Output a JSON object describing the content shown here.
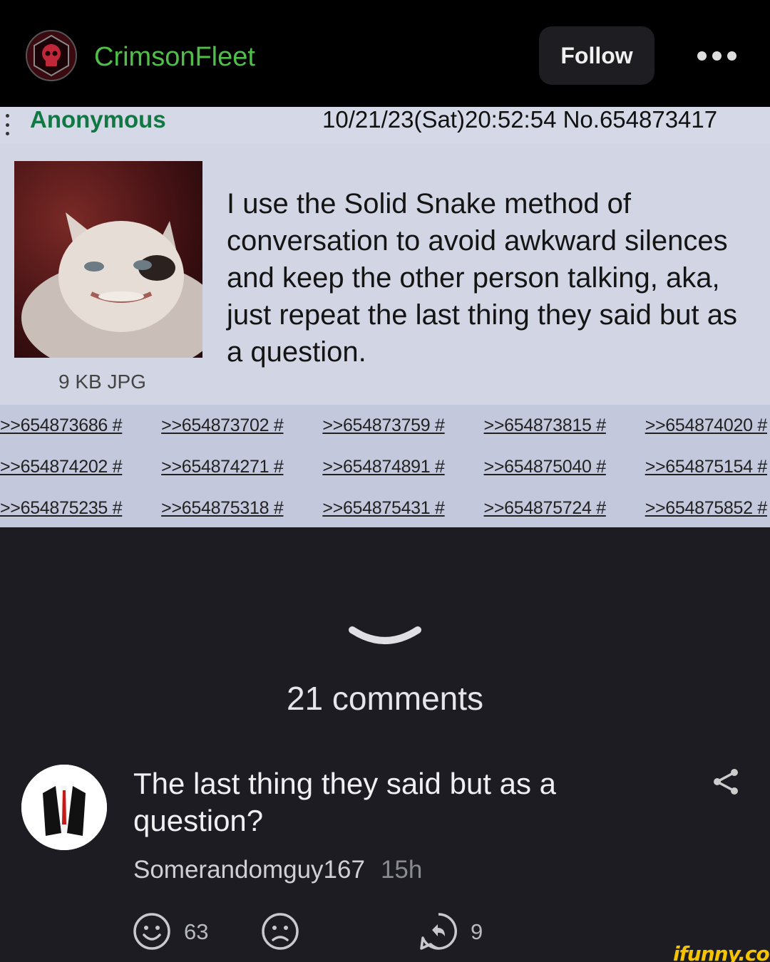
{
  "header": {
    "channel_name": "CrimsonFleet",
    "follow_label": "Follow",
    "avatar_icon": "skull-hexagon-icon",
    "more_icon": "more-dots-icon"
  },
  "post": {
    "poster_name": "Anonymous",
    "date_line": "10/21/23(Sat)20:52:54 No.654873417",
    "file_info": "9 KB JPG",
    "text": "I use the Solid Snake method of conversation to avoid awkward silences and keep the other person talking, aka, just repeat the last thing they said but as a question.",
    "replies": [
      [
        ">>654873686 #",
        ">>654873702 #",
        ">>654873759 #",
        ">>654873815 #",
        ">>654874020 #"
      ],
      [
        ">>654874202 #",
        ">>654874271 #",
        ">>654874891 #",
        ">>654875040 #",
        ">>654875154 #"
      ],
      [
        ">>654875235 #",
        ">>654875318 #",
        ">>654875431 #",
        ">>654875724 #",
        ">>654875852 #"
      ]
    ]
  },
  "comments": {
    "count_label": "21 comments",
    "items": [
      {
        "text": "The last thing they said but as a question?",
        "author": "Somerandomguy167",
        "time": "15h",
        "smile_count": "63",
        "reply_count": "9"
      }
    ]
  },
  "watermark": "ifunny.co",
  "colors": {
    "channel_name": "#4fbf4a",
    "poster_name": "#117743",
    "post_background": "#d2d5e4",
    "page_background": "#1c1c22",
    "watermark": "#f5c400"
  }
}
